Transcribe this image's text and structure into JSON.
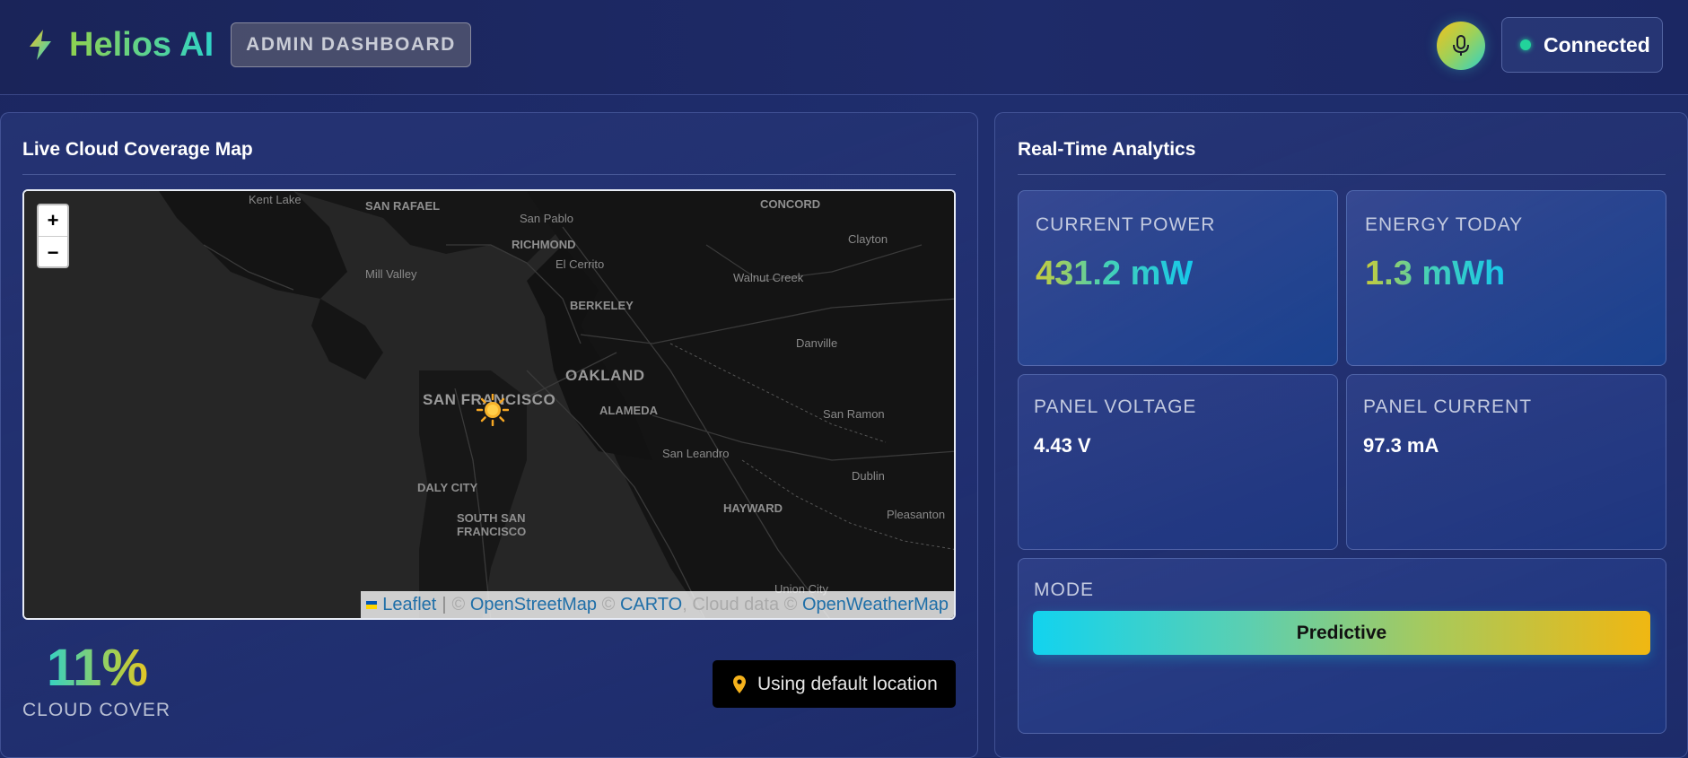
{
  "header": {
    "brand": "Helios AI",
    "badge": "ADMIN DASHBOARD",
    "connection_status": "Connected",
    "icons": {
      "logo": "lightning-bolt-icon",
      "mic": "microphone-icon",
      "status": "status-dot-icon"
    },
    "colors": {
      "status_online": "#22d39b",
      "accent_green": "#8fd14f",
      "accent_teal": "#2fd3c7",
      "accent_yellow": "#f2c21c"
    }
  },
  "map_panel": {
    "title": "Live Cloud Coverage Map",
    "zoom_in": "+",
    "zoom_out": "−",
    "labels": {
      "kent_lake": "Kent Lake",
      "san_rafael": "SAN RAFAEL",
      "san_pablo": "San Pablo",
      "concord": "CONCORD",
      "richmond": "RICHMOND",
      "el_cerrito": "El Cerrito",
      "clayton": "Clayton",
      "mill_valley": "Mill Valley",
      "walnut_creek": "Walnut Creek",
      "berkeley": "BERKELEY",
      "danville": "Danville",
      "oakland": "OAKLAND",
      "san_francisco": "SAN FRANCISCO",
      "alameda": "ALAMEDA",
      "san_ramon": "San Ramon",
      "san_leandro": "San Leandro",
      "dublin": "Dublin",
      "daly_city": "DALY CITY",
      "hayward": "HAYWARD",
      "pleasanton": "Pleasanton",
      "south_sf_1": "SOUTH SAN",
      "south_sf_2": "FRANCISCO",
      "union_city": "Union City"
    },
    "attribution": {
      "leaflet": "Leaflet",
      "sep": "|",
      "copy1": "©",
      "osm": "OpenStreetMap",
      "copy2": "©",
      "carto": "CARTO",
      "cloud_data": ", Cloud data ©",
      "owm": "OpenWeatherMap"
    },
    "cloud_cover_value": "11%",
    "cloud_cover_label": "CLOUD COVER",
    "location_button": "Using default location",
    "icons": {
      "weather": "sun-icon",
      "location": "map-pin-icon"
    }
  },
  "analytics": {
    "title": "Real-Time Analytics",
    "current_power": {
      "label": "CURRENT POWER",
      "value": "431.2 mW"
    },
    "energy_today": {
      "label": "ENERGY TODAY",
      "value": "1.3 mWh"
    },
    "panel_voltage": {
      "label": "PANEL VOLTAGE",
      "value": "4.43 V"
    },
    "panel_current": {
      "label": "PANEL CURRENT",
      "value": "97.3 mA"
    },
    "mode": {
      "label": "MODE",
      "value": "Predictive"
    }
  }
}
